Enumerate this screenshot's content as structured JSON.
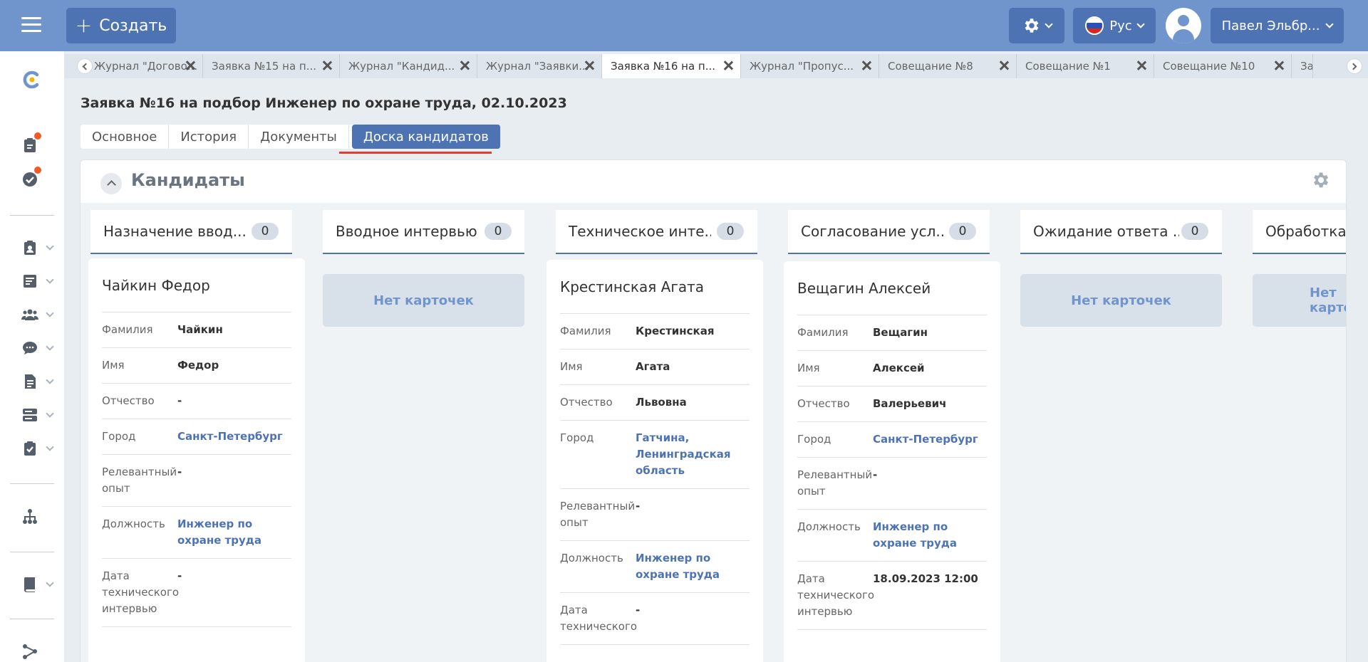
{
  "header": {
    "create_label": "Создать",
    "lang_label": "Рус",
    "user_name": "Павел Эльбр..."
  },
  "tabs": [
    {
      "label": "Журнал \"Догово...",
      "active": false
    },
    {
      "label": "Заявка №15 на п...",
      "active": false
    },
    {
      "label": "Журнал \"Кандид...",
      "active": false
    },
    {
      "label": "Журнал \"Заявки...",
      "active": false
    },
    {
      "label": "Заявка №16 на п...",
      "active": true
    },
    {
      "label": "Журнал \"Пропус...",
      "active": false
    },
    {
      "label": "Совещание №8",
      "active": false
    },
    {
      "label": "Совещание №1",
      "active": false
    },
    {
      "label": "Совещание №10",
      "active": false
    },
    {
      "label": "За",
      "active": false
    }
  ],
  "page": {
    "title": "Заявка №16 на подбор Инженер по охране труда, 02.10.2023",
    "sub_tabs": [
      "Основное",
      "История",
      "Документы",
      "Доска кандидатов"
    ],
    "active_sub_tab": "Доска кандидатов"
  },
  "board": {
    "title": "Кандидаты",
    "empty_text": "Нет карточек",
    "columns": [
      {
        "name": "Назначение ввод...",
        "count": "0"
      },
      {
        "name": "Вводное интервью",
        "count": "0"
      },
      {
        "name": "Техническое инте...",
        "count": "0"
      },
      {
        "name": "Согласование усл...",
        "count": "0"
      },
      {
        "name": "Ожидание ответа ...",
        "count": "0"
      },
      {
        "name": "Обработка"
      }
    ],
    "cards": [
      {
        "name": "Чайкин Федор",
        "rows": [
          {
            "label": "Фамилия",
            "value": "Чайкин",
            "link": false
          },
          {
            "label": "Имя",
            "value": "Федор",
            "link": false
          },
          {
            "label": "Отчество",
            "value": "-",
            "link": false
          },
          {
            "label": "Город",
            "value": "Санкт-Петербург",
            "link": true
          },
          {
            "label": "Релевантный опыт",
            "value": "-",
            "link": false
          },
          {
            "label": "Должность",
            "value": "Инженер по охране труда",
            "link": true
          },
          {
            "label": "Дата технического интервью",
            "value": "-",
            "link": false
          }
        ]
      },
      {
        "name": "Крестинская Агата",
        "rows": [
          {
            "label": "Фамилия",
            "value": "Крестинская",
            "link": false
          },
          {
            "label": "Имя",
            "value": "Агата",
            "link": false
          },
          {
            "label": "Отчество",
            "value": "Львовна",
            "link": false
          },
          {
            "label": "Город",
            "value": "Гатчина, Ленинградская область",
            "link": true
          },
          {
            "label": "Релевантный опыт",
            "value": "-",
            "link": false
          },
          {
            "label": "Должность",
            "value": "Инженер по охране труда",
            "link": true
          },
          {
            "label": "Дата технического",
            "value": "-",
            "link": false
          }
        ]
      },
      {
        "name": "Вещагин Алексей",
        "rows": [
          {
            "label": "Фамилия",
            "value": "Вещагин",
            "link": false
          },
          {
            "label": "Имя",
            "value": "Алексей",
            "link": false
          },
          {
            "label": "Отчество",
            "value": "Валерьевич",
            "link": false
          },
          {
            "label": "Город",
            "value": "Санкт-Петербург",
            "link": true
          },
          {
            "label": "Релевантный опыт",
            "value": "-",
            "link": false
          },
          {
            "label": "Должность",
            "value": "Инженер по охране труда",
            "link": true
          },
          {
            "label": "Дата технического интервью",
            "value": "18.09.2023 12:00",
            "link": false
          }
        ]
      }
    ]
  },
  "colors": {
    "topbar": "#7094cc",
    "button": "#4d73b3",
    "accent_underline": "#e63b2e",
    "notification": "#f05a28"
  }
}
